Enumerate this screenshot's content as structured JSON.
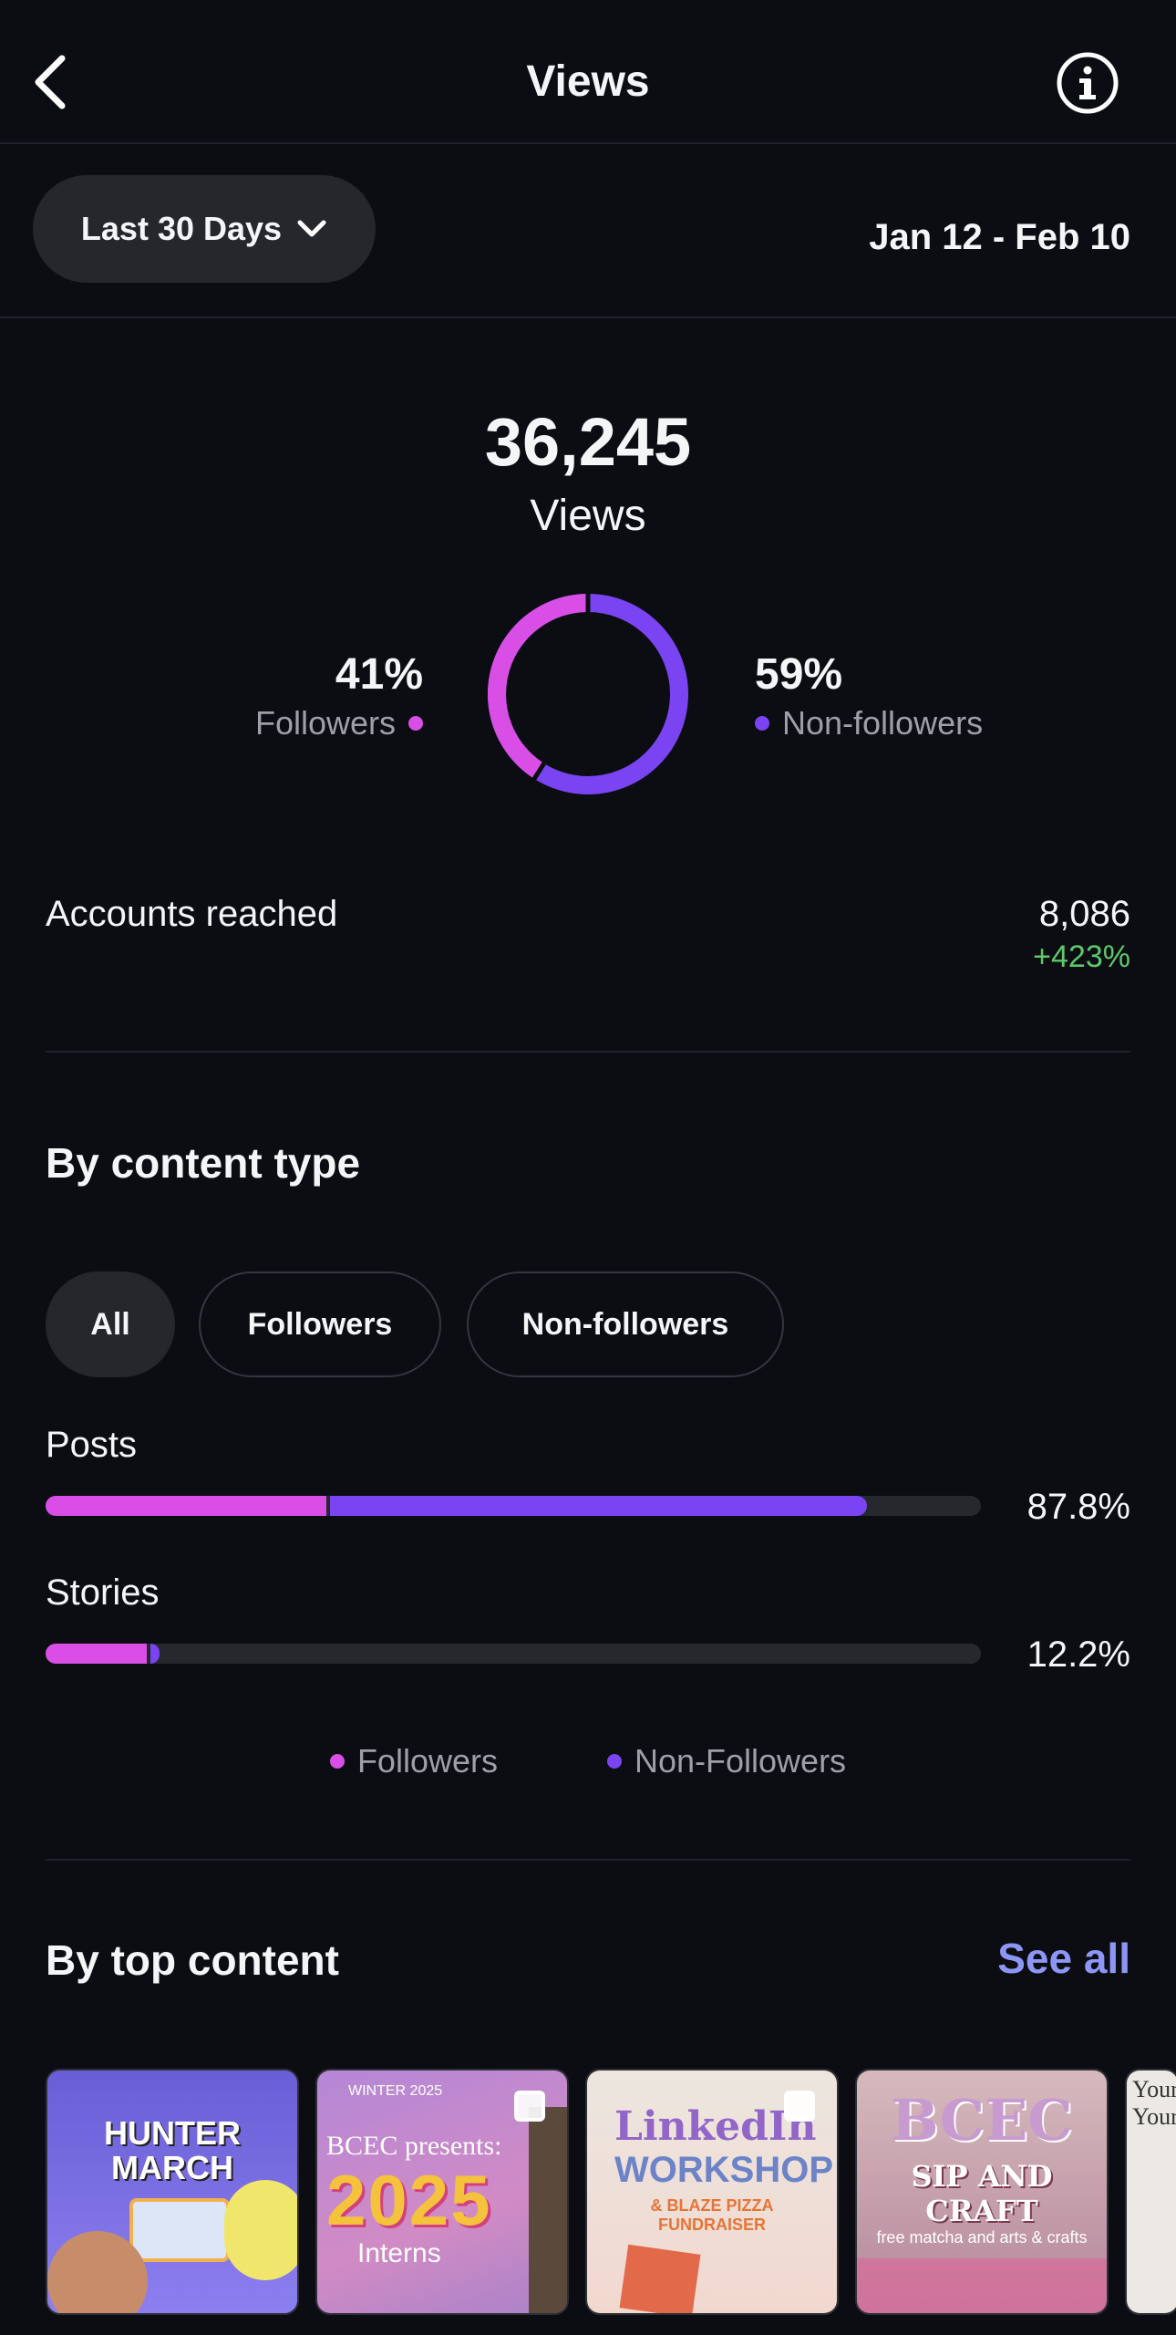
{
  "header": {
    "title": "Views",
    "back_icon": "chevron-left-icon",
    "info_icon": "info-icon"
  },
  "range": {
    "selected": "Last 30 Days",
    "dates": "Jan 12 - Feb 10"
  },
  "summary": {
    "total": "36,245",
    "label": "Views",
    "followers_pct": "41%",
    "followers_label": "Followers",
    "nonfollowers_pct": "59%",
    "nonfollowers_label": "Non-followers",
    "followers_fraction": 0.41,
    "nonfollowers_fraction": 0.59
  },
  "reach": {
    "label": "Accounts reached",
    "value": "8,086",
    "change": "+423%"
  },
  "content_type": {
    "title": "By content type",
    "filters": [
      "All",
      "Followers",
      "Non-followers"
    ],
    "active_filter": "All",
    "rows": [
      {
        "label": "Posts",
        "pct": "87.8%",
        "followers_fraction": 0.3,
        "nonfollowers_fraction": 0.578
      },
      {
        "label": "Stories",
        "pct": "12.2%",
        "followers_fraction": 0.108,
        "nonfollowers_fraction": 0.014
      }
    ],
    "legend": [
      "Followers",
      "Non-Followers"
    ]
  },
  "top_content": {
    "title": "By top content",
    "see_all": "See all",
    "thumbs": [
      {
        "line1": "HUNTER",
        "line2": "MARCH"
      },
      {
        "line1": "WINTER 2025",
        "line2": "BCEC presents:",
        "line3": "2025",
        "line4": "Interns"
      },
      {
        "line1": "LinkedIn",
        "line2": "WORKSHOP",
        "line3": "& BLAZE PIZZA",
        "line4": "FUNDRAISER"
      },
      {
        "line1": "BCEC",
        "line2": "SIP AND CRAFT",
        "line3": "free matcha and arts & crafts"
      },
      {
        "line1": "Your",
        "line2": "Your"
      }
    ]
  },
  "colors": {
    "followers": "#d94fe6",
    "nonfollowers": "#7b44f2",
    "accent_link": "#8e96f5",
    "positive": "#5cc86a"
  }
}
